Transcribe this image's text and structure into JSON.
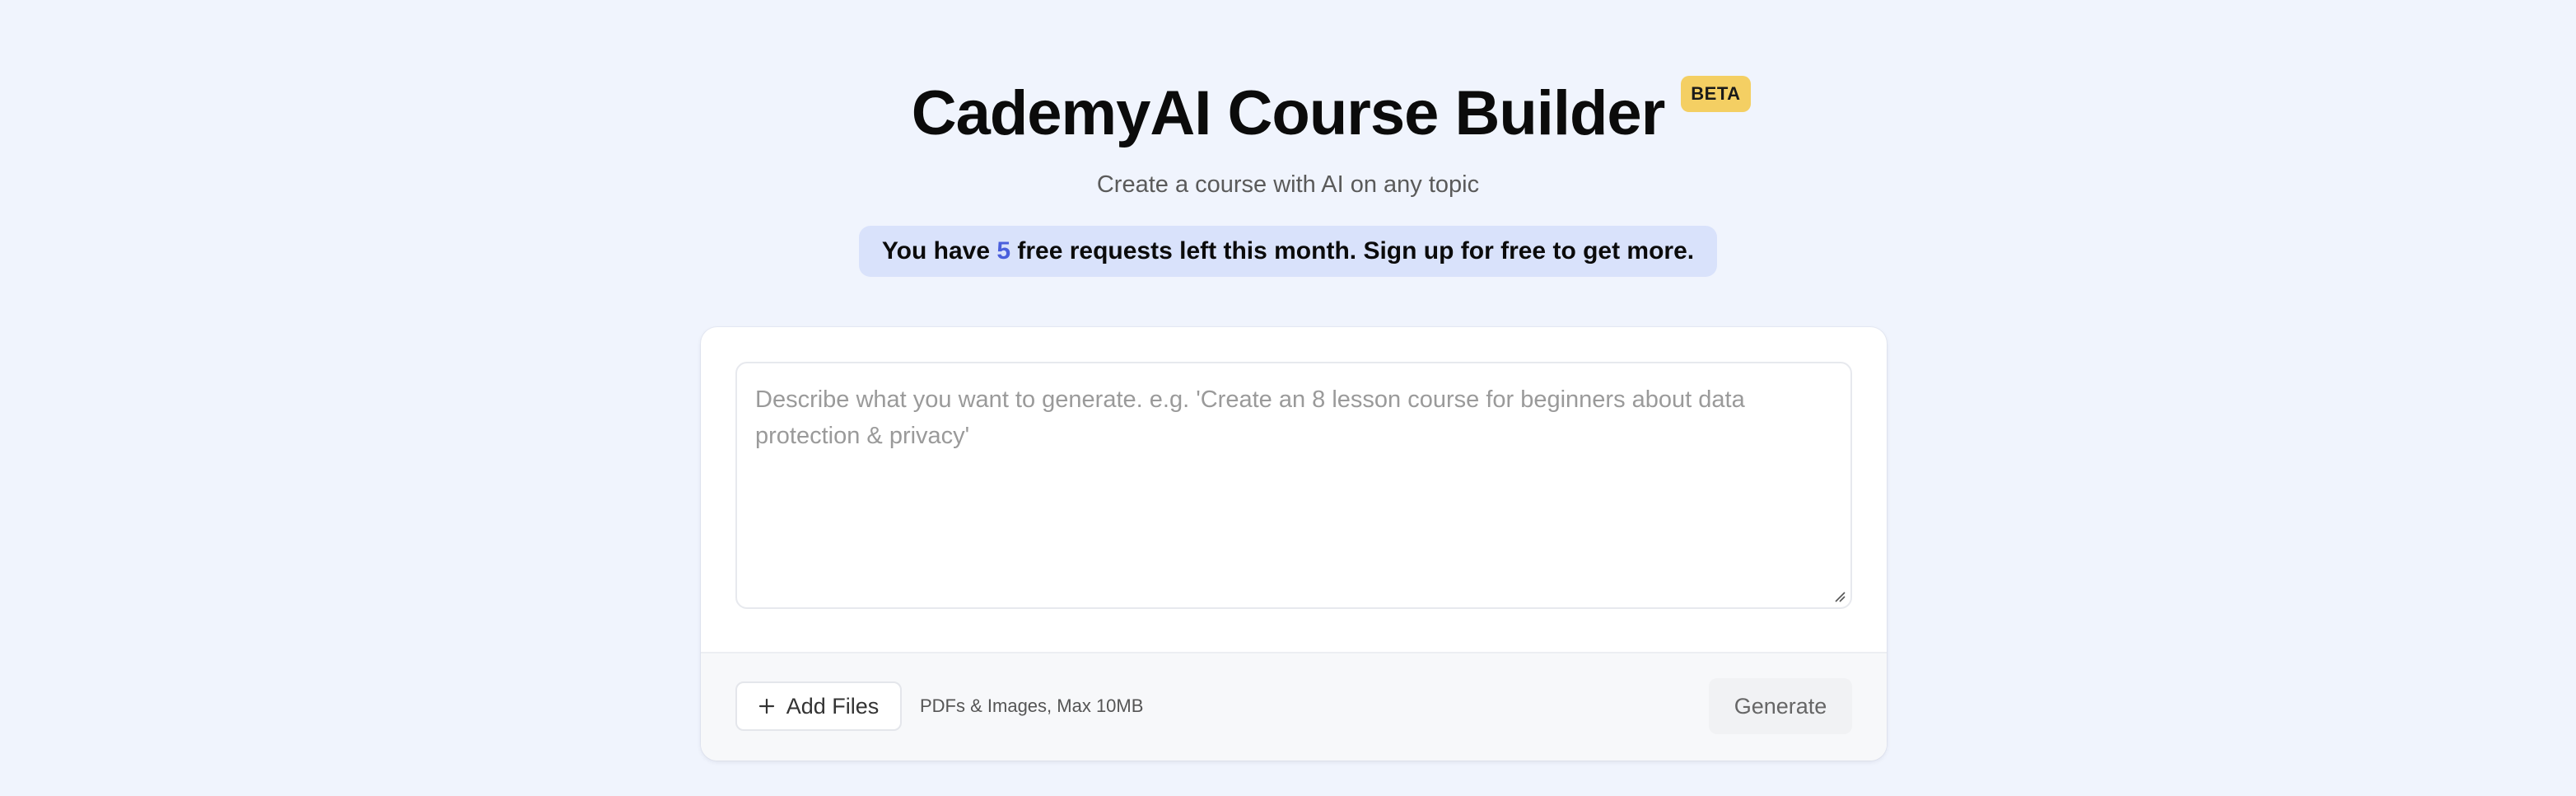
{
  "header": {
    "title": "CademyAI Course Builder",
    "badge": "BETA",
    "subtitle": "Create a course with AI on any topic"
  },
  "notice": {
    "prefix": "You have ",
    "count": "5",
    "suffix": " free requests left this month. Sign up for free to get more."
  },
  "prompt": {
    "placeholder": "Describe what you want to generate. e.g. 'Create an 8 lesson course for beginners about data protection & privacy'",
    "value": ""
  },
  "footer": {
    "add_files_label": "Add Files",
    "add_files_icon": "plus-icon",
    "file_hint": "PDFs & Images, Max 10MB",
    "generate_label": "Generate"
  },
  "colors": {
    "page_background": "#f0f4fd",
    "badge_background": "#f4cf63",
    "notice_background": "#d9e2fb",
    "notice_count": "#4a5fdc"
  }
}
